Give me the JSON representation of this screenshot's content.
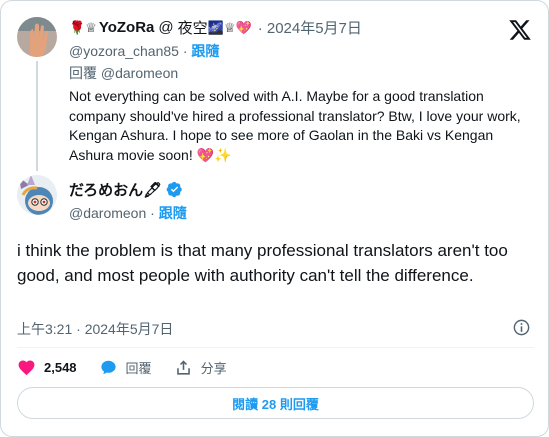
{
  "parent_tweet": {
    "display_name": "YoZoRa",
    "name_prefix_emoji": "🌹♕",
    "name_at": "@",
    "name_jp": "夜空",
    "name_suffix_emoji": "🌌♕💖",
    "time": "· 2024年5月7日",
    "handle": "@yozora_chan85",
    "follow_sep": " · ",
    "follow_label": "跟隨",
    "reply_to_label": "回覆",
    "reply_to_handle": "@daromeon",
    "text": "Not everything can be solved with A.I. Maybe for a good translation company should've hired a professional translator? Btw, I love your work, Kengan Ashura. I hope to see more of Gaolan in the Baki vs Kengan Ashura movie soon! 💖✨"
  },
  "main_tweet": {
    "display_name": "だろめおん🖋",
    "verified": true,
    "handle": "@daromeon",
    "follow_sep": " · ",
    "follow_label": "跟隨",
    "text": "i think the problem is that many professional translators aren't too good, and most people with authority can't tell the difference.",
    "timestamp": "上午3:21 · 2024年5月7日"
  },
  "actions": {
    "like_count": "2,548",
    "reply_label": "回覆",
    "share_label": "分享"
  },
  "read_replies_label": "閱讀 28 則回覆",
  "colors": {
    "accent": "#1d9bf0",
    "like": "#f91880",
    "text": "#0f1419",
    "muted": "#536471",
    "border": "#cfd9de"
  },
  "icons": [
    "x-logo-icon",
    "verified-badge-icon",
    "heart-icon",
    "reply-bubble-icon",
    "share-icon",
    "info-icon"
  ]
}
